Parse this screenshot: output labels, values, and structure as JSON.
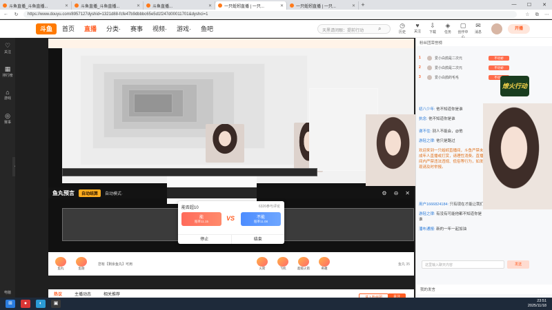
{
  "browser": {
    "tabs": [
      {
        "label": "斗鱼直播_斗鱼直播...",
        "active": false
      },
      {
        "label": "斗鱼直播_斗鱼直播...",
        "active": false
      },
      {
        "label": "斗鱼直播...",
        "active": false
      },
      {
        "label": "一只蚯蚓直播 | 一只...",
        "active": true
      },
      {
        "label": "一只蚯蚓直播 | 一只...",
        "active": false
      }
    ],
    "new_tab": "+",
    "url": "https://www.douyu.com/8957127dyshid=1321d88-fcfe47b9dbbbc65e5d1f247d00011701&dyshci=1"
  },
  "site": {
    "logo": "斗鱼",
    "nav": [
      "首页",
      "直播",
      "分类·",
      "赛事",
      "视频·",
      "游戏·",
      "鱼吧"
    ],
    "active_nav": "直播",
    "search_placeholder": "天黑请闭眼：提前行动",
    "header_icons": [
      {
        "glyph": "◷",
        "label": "历史"
      },
      {
        "glyph": "♥",
        "label": "关注"
      },
      {
        "glyph": "⇩",
        "label": "下载"
      },
      {
        "glyph": "◈",
        "label": "任务"
      },
      {
        "glyph": "▢",
        "label": "创作中心"
      },
      {
        "glyph": "✉",
        "label": "消息"
      }
    ],
    "start_label": "开播"
  },
  "sidebar": {
    "items": [
      {
        "glyph": "♡",
        "label": "关注"
      },
      {
        "glyph": "▦",
        "label": "排行榜"
      },
      {
        "glyph": "⌂",
        "label": "游戏"
      },
      {
        "glyph": "◎",
        "label": "赛事"
      }
    ],
    "bottom": "电脑"
  },
  "prediction": {
    "logo": "鱼丸预言",
    "badge": "自动结算",
    "mode": "自动模式·",
    "icons": [
      "⚙",
      "⊖",
      "✕"
    ],
    "card_title": "能否超10",
    "count": "6326参与评论",
    "option_a": {
      "label": "能",
      "sub": "赔率11.15"
    },
    "option_b": {
      "label": "不能",
      "sub": "赔率11.08"
    },
    "vs": "VS",
    "stop_label": "停止",
    "end_label": "结束"
  },
  "gifts": {
    "items": [
      "鱼丸",
      "鱼翅",
      "火箭",
      "飞机",
      "超级火箭",
      "奇趣"
    ],
    "note": "您有【剩余鱼丸】可用",
    "balance": "鱼丸 35"
  },
  "room_tabs": {
    "items": [
      "热议",
      "主播动态",
      "相关推荐"
    ],
    "join_label": "进入粉丝团",
    "follow_label": "关注"
  },
  "chat": {
    "header": "粉丝团荣誉榜",
    "ranks": [
      {
        "n": "1",
        "name": "爱小白鸽是二次元",
        "lvl": "不尽娇"
      },
      {
        "n": "2",
        "name": "爱小白鸽是二次元",
        "lvl": "不尽娇"
      },
      {
        "n": "3",
        "name": "爱小白鸽的毛毛",
        "lvl": "不尽娇"
      }
    ],
    "messages": [
      {
        "user": "初八少年:",
        "text": "他不知道你是谁"
      },
      {
        "user": "执念:",
        "text": "他不知道你是谁"
      },
      {
        "user": "谢不住:",
        "text": "别人不能会，@他"
      },
      {
        "user": "游轻之律:",
        "text": "他只是路过"
      }
    ],
    "system": "欢迎来到一只蚯蚓直播间，斗鱼严禁未成年人直播或打赏，请理性消费。直播间内严禁违法违规、低俗等行为，如发现请及时举报。",
    "more": [
      {
        "user": "用户1666824184:",
        "text": "只有现在才能让我们"
      },
      {
        "user": "游轻之律:",
        "text": "有没有可能他都不知道你是谁"
      },
      {
        "user": "潘布通报:",
        "text": "新的一年一起加油"
      }
    ],
    "input_placeholder": "这里输入聊天内容",
    "send_label": "发送",
    "bottom_label": "我的发言",
    "stream_badge": "燎火行动"
  },
  "taskbar": {
    "time": "23:51",
    "date": "2025/11/18"
  }
}
